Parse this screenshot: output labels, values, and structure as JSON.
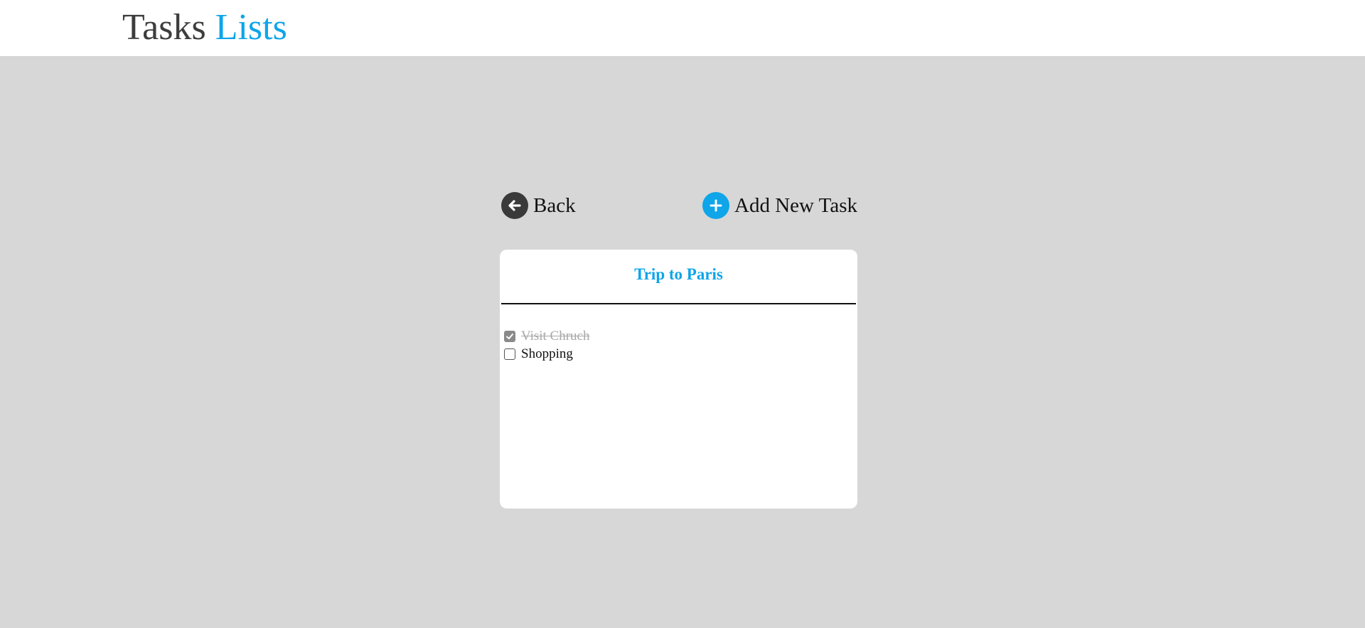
{
  "header": {
    "logo_part1": "Tasks",
    "logo_part2": "Lists"
  },
  "actions": {
    "back_label": "Back",
    "add_label": "Add New Task"
  },
  "list": {
    "title": "Trip to Paris",
    "tasks": [
      {
        "label": "Visit Chruch",
        "done": true
      },
      {
        "label": "Shopping",
        "done": false
      }
    ]
  },
  "colors": {
    "accent": "#0ea5e9",
    "background": "#d7d7d7",
    "dark_icon": "#3a3a3a",
    "done_text": "#a8a8a8"
  },
  "icons": {
    "back": "arrow-left-circle-icon",
    "add": "plus-circle-icon",
    "check": "check-icon"
  }
}
